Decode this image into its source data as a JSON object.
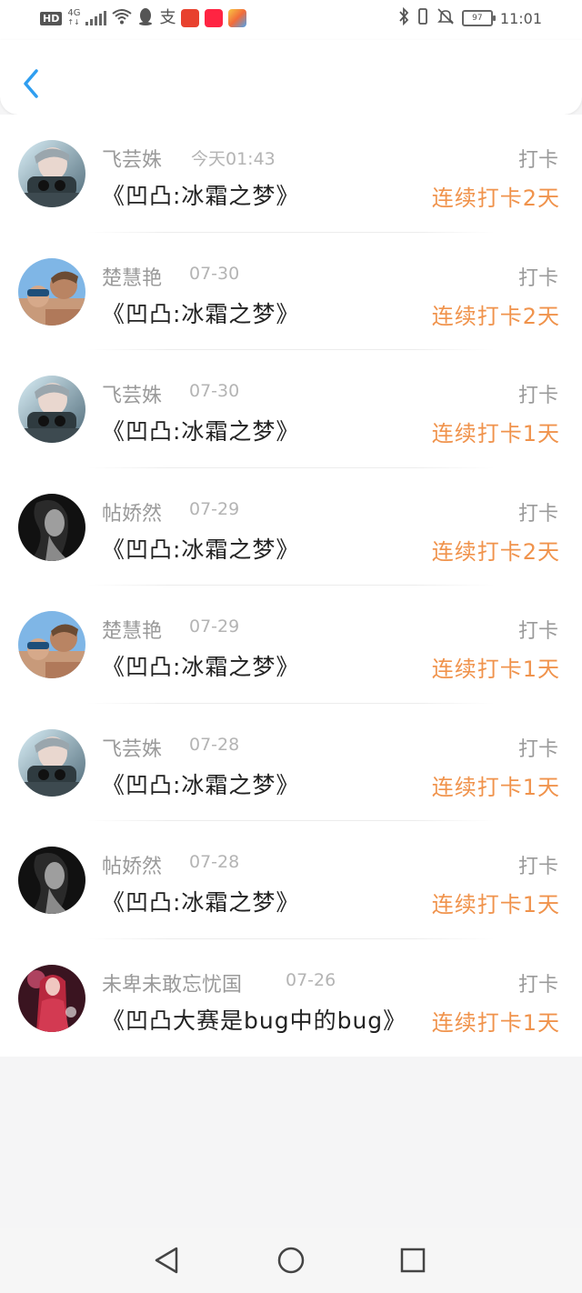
{
  "status_bar": {
    "hd": "HD",
    "network": "4G",
    "network_sub": "↑↓",
    "battery_level": "97",
    "time": "11:01",
    "icons": [
      "signal-icon",
      "wifi-icon",
      "qq-icon",
      "alipay-icon",
      "app-red-icon",
      "app-xiaohongshu-icon",
      "app-yellow-icon",
      "bluetooth-icon",
      "vibrate-icon",
      "mute-icon",
      "battery-icon"
    ]
  },
  "header": {
    "back_icon": "chevron-left-icon",
    "accent": "#2f9ef0"
  },
  "items": [
    {
      "avatar": "avatar-1",
      "name": "飞芸姝",
      "date": "今天01:43",
      "title": "《凹凸:冰霜之梦》",
      "tag": "打卡",
      "streak": "连续打卡2天"
    },
    {
      "avatar": "avatar-2",
      "name": "楚慧艳",
      "date": "07-30",
      "title": "《凹凸:冰霜之梦》",
      "tag": "打卡",
      "streak": "连续打卡2天"
    },
    {
      "avatar": "avatar-1",
      "name": "飞芸姝",
      "date": "07-30",
      "title": "《凹凸:冰霜之梦》",
      "tag": "打卡",
      "streak": "连续打卡1天"
    },
    {
      "avatar": "avatar-3",
      "name": "帖娇然",
      "date": "07-29",
      "title": "《凹凸:冰霜之梦》",
      "tag": "打卡",
      "streak": "连续打卡2天"
    },
    {
      "avatar": "avatar-2",
      "name": "楚慧艳",
      "date": "07-29",
      "title": "《凹凸:冰霜之梦》",
      "tag": "打卡",
      "streak": "连续打卡1天"
    },
    {
      "avatar": "avatar-1",
      "name": "飞芸姝",
      "date": "07-28",
      "title": "《凹凸:冰霜之梦》",
      "tag": "打卡",
      "streak": "连续打卡1天"
    },
    {
      "avatar": "avatar-3",
      "name": "帖娇然",
      "date": "07-28",
      "title": "《凹凸:冰霜之梦》",
      "tag": "打卡",
      "streak": "连续打卡1天"
    },
    {
      "avatar": "avatar-4",
      "name": "未卑未敢忘忧国",
      "date": "07-26",
      "title": "《凹凸大赛是bug中的bug》",
      "tag": "打卡",
      "streak": "连续打卡1天"
    }
  ],
  "colors": {
    "streak": "#f0934c",
    "name": "#9a9a9a",
    "date": "#b4b4b4",
    "title": "#222222"
  },
  "navbar": {
    "icons": [
      "back-triangle-icon",
      "home-circle-icon",
      "recents-square-icon"
    ]
  }
}
